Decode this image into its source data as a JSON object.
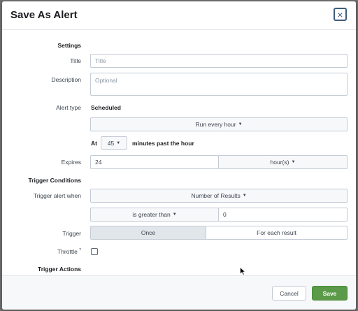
{
  "dialog": {
    "title": "Save As Alert",
    "close_glyph": "×"
  },
  "settings": {
    "heading": "Settings",
    "title_label": "Title",
    "title_placeholder": "Title",
    "description_label": "Description",
    "description_placeholder": "Optional",
    "alert_type_label": "Alert type",
    "alert_type_value": "Scheduled",
    "schedule_option": "Run every hour",
    "at_label": "At",
    "minute_value": "45",
    "minutes_suffix": "minutes past the hour",
    "expires_label": "Expires",
    "expires_value": "24",
    "expires_unit": "hour(s)"
  },
  "trigger": {
    "heading": "Trigger Conditions",
    "when_label": "Trigger alert when",
    "condition": "Number of Results",
    "comparator": "is greater than",
    "threshold": "0",
    "trigger_label": "Trigger",
    "mode_once": "Once",
    "mode_each": "For each result",
    "throttle_label": "Throttle",
    "throttle_help": "?"
  },
  "actions": {
    "heading": "Trigger Actions"
  },
  "footer": {
    "cancel_label": "Cancel",
    "save_label": "Save"
  },
  "colors": {
    "save_green": "#5a9a48",
    "close_blue": "#3e5d7a"
  },
  "icons": {
    "caret": "caret-down-icon",
    "close": "close-icon",
    "cursor": "mouse-pointer-icon"
  }
}
